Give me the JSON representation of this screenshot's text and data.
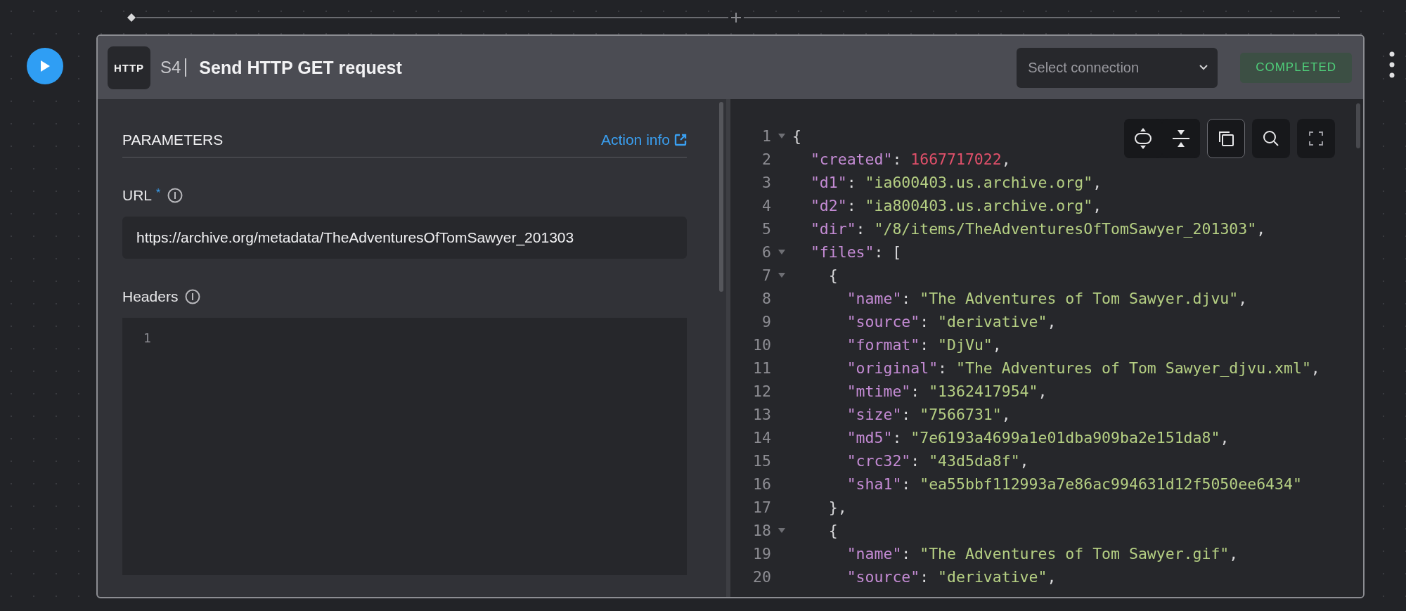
{
  "step": {
    "icon_label": "HTTP",
    "number": "S4",
    "title": "Send HTTP GET request",
    "connection": {
      "placeholder": "Select connection"
    },
    "status": {
      "label": "COMPLETED",
      "kind": "success"
    }
  },
  "parameters": {
    "heading": "PARAMETERS",
    "action_info": "Action info",
    "fields": [
      {
        "kind": "text",
        "label": "URL",
        "required_mark": "*",
        "value": "https://archive.org/metadata/TheAdventuresOfTomSawyer_201303"
      },
      {
        "kind": "editor",
        "label": "Headers",
        "line_numbers": [
          "1"
        ]
      }
    ]
  },
  "code_toolbar": [
    {
      "focused": false
    },
    {
      "focused": false
    },
    {
      "focused": true
    },
    {
      "focused": false
    },
    {
      "focused": false
    }
  ],
  "output_lines": [
    {
      "number": "1",
      "foldable": true,
      "tokens": [
        {
          "kind": "punct",
          "text": "{"
        }
      ],
      "children": [
        {
          "number": "2",
          "foldable": false,
          "tokens": [
            {
              "kind": "key",
              "text": "\"created\""
            },
            {
              "kind": "punct",
              "text": ": "
            },
            {
              "kind": "number",
              "text": "1667717022"
            },
            {
              "kind": "punct",
              "text": ","
            }
          ]
        },
        {
          "number": "3",
          "foldable": false,
          "tokens": [
            {
              "kind": "key",
              "text": "\"d1\""
            },
            {
              "kind": "punct",
              "text": ": "
            },
            {
              "kind": "string",
              "text": "\"ia600403.us.archive.org\""
            },
            {
              "kind": "punct",
              "text": ","
            }
          ]
        },
        {
          "number": "4",
          "foldable": false,
          "tokens": [
            {
              "kind": "key",
              "text": "\"d2\""
            },
            {
              "kind": "punct",
              "text": ": "
            },
            {
              "kind": "string",
              "text": "\"ia800403.us.archive.org\""
            },
            {
              "kind": "punct",
              "text": ","
            }
          ]
        },
        {
          "number": "5",
          "foldable": false,
          "tokens": [
            {
              "kind": "key",
              "text": "\"dir\""
            },
            {
              "kind": "punct",
              "text": ": "
            },
            {
              "kind": "string",
              "text": "\"/8/items/TheAdventuresOfTomSawyer_201303\""
            },
            {
              "kind": "punct",
              "text": ","
            }
          ]
        },
        {
          "number": "6",
          "foldable": true,
          "tokens": [
            {
              "kind": "key",
              "text": "\"files\""
            },
            {
              "kind": "punct",
              "text": ": ["
            }
          ],
          "children": [
            {
              "number": "7",
              "foldable": true,
              "tokens": [
                {
                  "kind": "punct",
                  "text": "{"
                }
              ],
              "children": [
                {
                  "number": "8",
                  "foldable": false,
                  "tokens": [
                    {
                      "kind": "key",
                      "text": "\"name\""
                    },
                    {
                      "kind": "punct",
                      "text": ": "
                    },
                    {
                      "kind": "string",
                      "text": "\"The Adventures of Tom Sawyer.djvu\""
                    },
                    {
                      "kind": "punct",
                      "text": ","
                    }
                  ]
                },
                {
                  "number": "9",
                  "foldable": false,
                  "tokens": [
                    {
                      "kind": "key",
                      "text": "\"source\""
                    },
                    {
                      "kind": "punct",
                      "text": ": "
                    },
                    {
                      "kind": "string",
                      "text": "\"derivative\""
                    },
                    {
                      "kind": "punct",
                      "text": ","
                    }
                  ]
                },
                {
                  "number": "10",
                  "foldable": false,
                  "tokens": [
                    {
                      "kind": "key",
                      "text": "\"format\""
                    },
                    {
                      "kind": "punct",
                      "text": ": "
                    },
                    {
                      "kind": "string",
                      "text": "\"DjVu\""
                    },
                    {
                      "kind": "punct",
                      "text": ","
                    }
                  ]
                },
                {
                  "number": "11",
                  "foldable": false,
                  "tokens": [
                    {
                      "kind": "key",
                      "text": "\"original\""
                    },
                    {
                      "kind": "punct",
                      "text": ": "
                    },
                    {
                      "kind": "string",
                      "text": "\"The Adventures of Tom Sawyer_djvu.xml\""
                    },
                    {
                      "kind": "punct",
                      "text": ","
                    }
                  ]
                },
                {
                  "number": "12",
                  "foldable": false,
                  "tokens": [
                    {
                      "kind": "key",
                      "text": "\"mtime\""
                    },
                    {
                      "kind": "punct",
                      "text": ": "
                    },
                    {
                      "kind": "string",
                      "text": "\"1362417954\""
                    },
                    {
                      "kind": "punct",
                      "text": ","
                    }
                  ]
                },
                {
                  "number": "13",
                  "foldable": false,
                  "tokens": [
                    {
                      "kind": "key",
                      "text": "\"size\""
                    },
                    {
                      "kind": "punct",
                      "text": ": "
                    },
                    {
                      "kind": "string",
                      "text": "\"7566731\""
                    },
                    {
                      "kind": "punct",
                      "text": ","
                    }
                  ]
                },
                {
                  "number": "14",
                  "foldable": false,
                  "tokens": [
                    {
                      "kind": "key",
                      "text": "\"md5\""
                    },
                    {
                      "kind": "punct",
                      "text": ": "
                    },
                    {
                      "kind": "string",
                      "text": "\"7e6193a4699a1e01dba909ba2e151da8\""
                    },
                    {
                      "kind": "punct",
                      "text": ","
                    }
                  ]
                },
                {
                  "number": "15",
                  "foldable": false,
                  "tokens": [
                    {
                      "kind": "key",
                      "text": "\"crc32\""
                    },
                    {
                      "kind": "punct",
                      "text": ": "
                    },
                    {
                      "kind": "string",
                      "text": "\"43d5da8f\""
                    },
                    {
                      "kind": "punct",
                      "text": ","
                    }
                  ]
                },
                {
                  "number": "16",
                  "foldable": false,
                  "tokens": [
                    {
                      "kind": "key",
                      "text": "\"sha1\""
                    },
                    {
                      "kind": "punct",
                      "text": ": "
                    },
                    {
                      "kind": "string",
                      "text": "\"ea55bbf112993a7e86ac994631d12f5050ee6434\""
                    }
                  ]
                }
              ],
              "closing": {
                "number": "17",
                "tokens": [
                  {
                    "kind": "punct",
                    "text": "},"
                  }
                ]
              }
            },
            {
              "number": "18",
              "foldable": true,
              "tokens": [
                {
                  "kind": "punct",
                  "text": "{"
                }
              ],
              "children": [
                {
                  "number": "19",
                  "foldable": false,
                  "tokens": [
                    {
                      "kind": "key",
                      "text": "\"name\""
                    },
                    {
                      "kind": "punct",
                      "text": ": "
                    },
                    {
                      "kind": "string",
                      "text": "\"The Adventures of Tom Sawyer.gif\""
                    },
                    {
                      "kind": "punct",
                      "text": ","
                    }
                  ]
                },
                {
                  "number": "20",
                  "foldable": false,
                  "tokens": [
                    {
                      "kind": "key",
                      "text": "\"source\""
                    },
                    {
                      "kind": "punct",
                      "text": ": "
                    },
                    {
                      "kind": "string",
                      "text": "\"derivative\""
                    },
                    {
                      "kind": "punct",
                      "text": ","
                    }
                  ]
                }
              ]
            }
          ]
        }
      ]
    }
  ]
}
